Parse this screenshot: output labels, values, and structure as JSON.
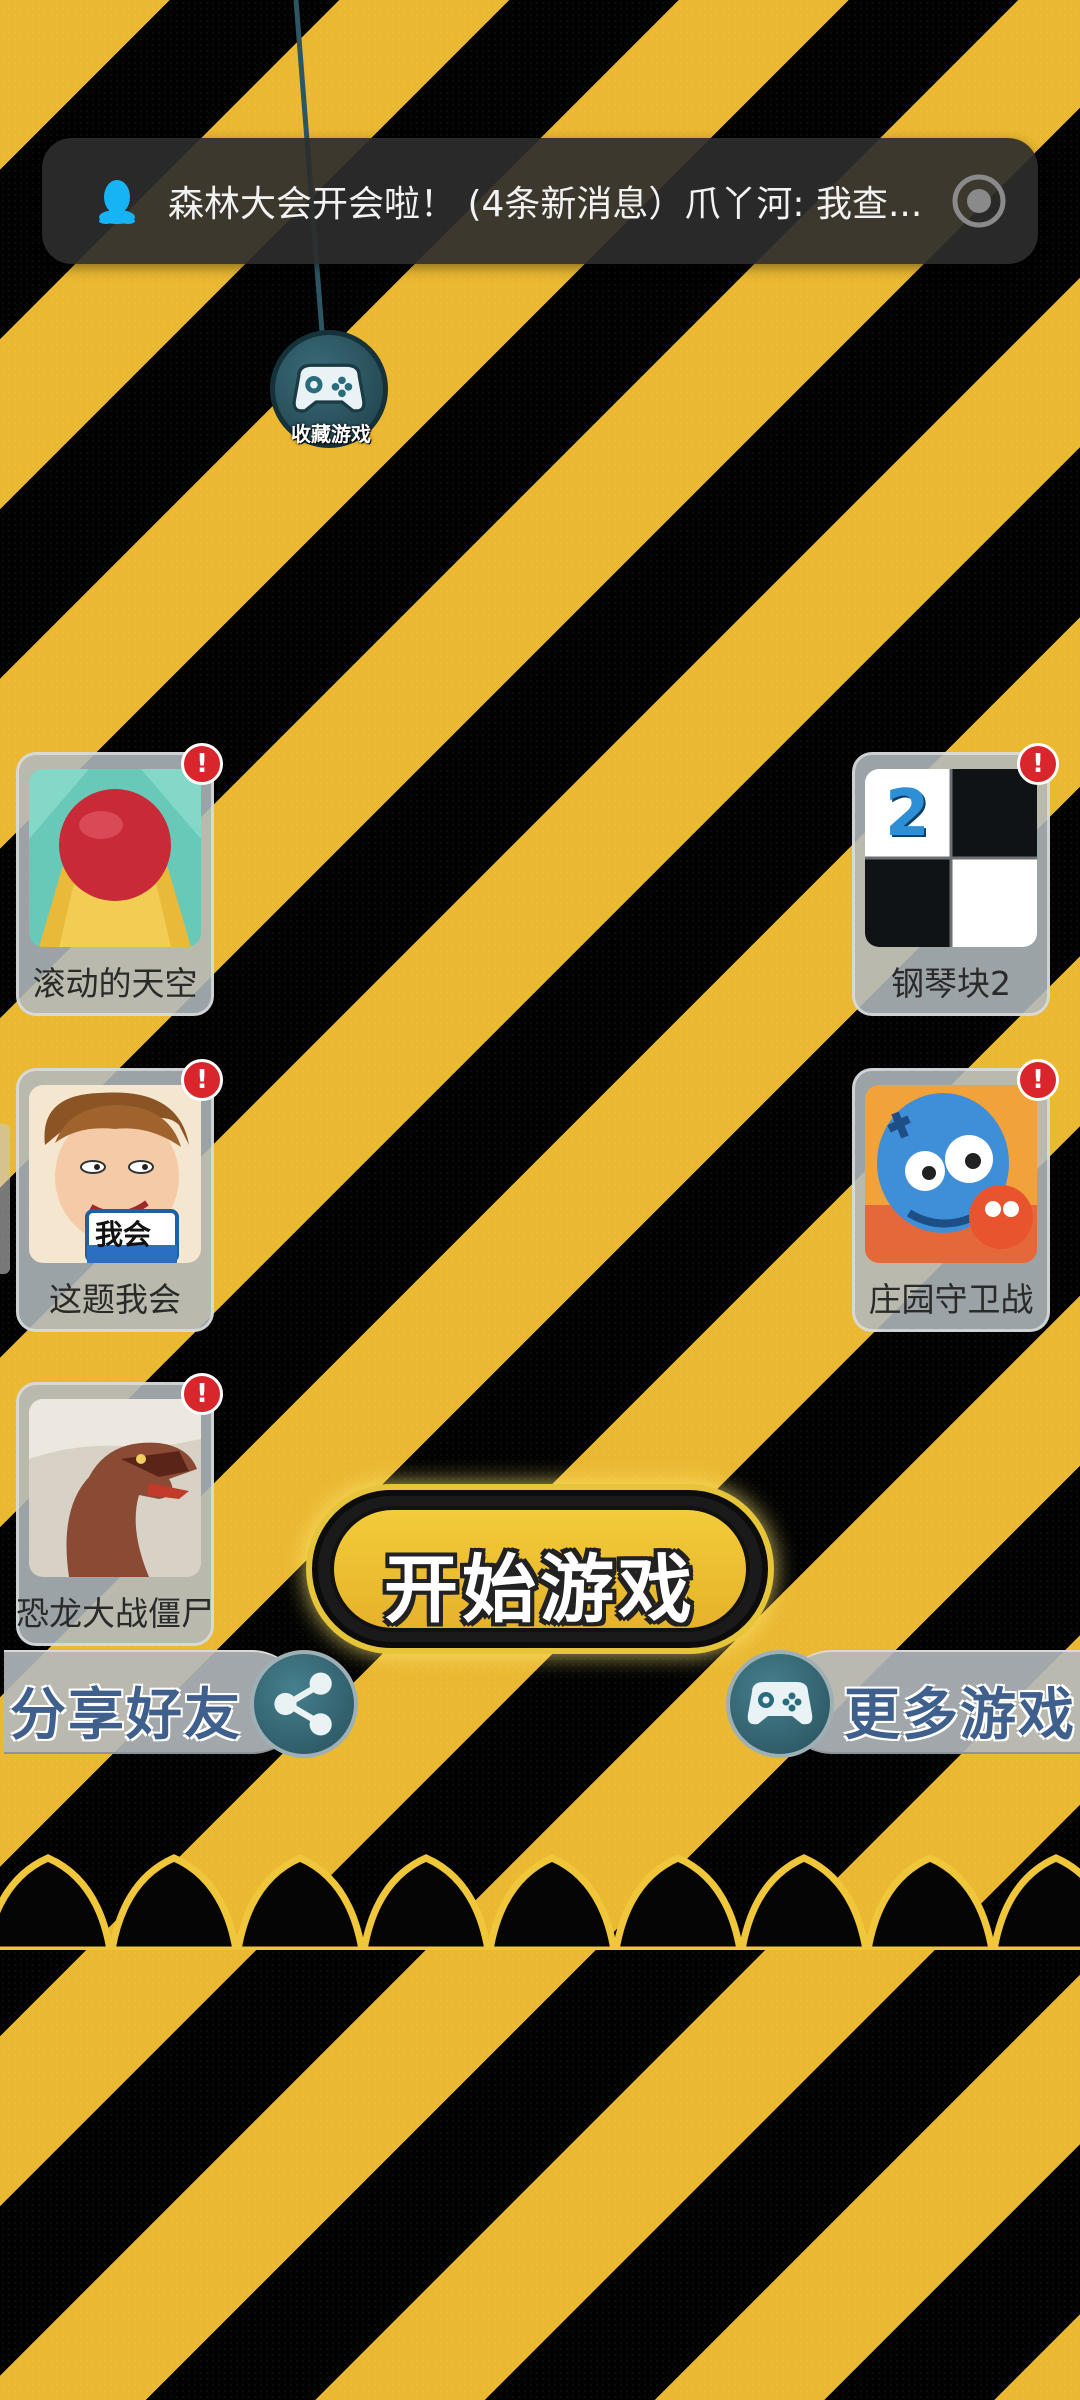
{
  "notification": {
    "app_icon": "qq-penguin-icon",
    "text": "森林大会开会啦！ (4条新消息）爪丫河: 我查...",
    "toggle_icon": "record-toggle-icon"
  },
  "favorite": {
    "label": "收藏游戏",
    "icon": "gamepad-icon"
  },
  "games": [
    {
      "title": "滚动的天空",
      "badge": "!"
    },
    {
      "title": "钢琴块2",
      "badge": "!",
      "tile_number": "2"
    },
    {
      "title": "这题我会",
      "badge": "!",
      "sign_text": "我会"
    },
    {
      "title": "庄园守卫战",
      "badge": "!"
    },
    {
      "title": "恐龙大战僵尸",
      "badge": "!"
    }
  ],
  "start_button": {
    "label": "开始游戏"
  },
  "share": {
    "label": "分享好友",
    "icon": "share-icon"
  },
  "more_games": {
    "label": "更多游戏",
    "icon": "gamepad-icon"
  },
  "colors": {
    "stripe_yellow": "#eab831",
    "stripe_black": "#020202",
    "badge_red": "#d8262c",
    "banner_text_blue": "#3f5f8c",
    "start_button_yellow": "#f2cc3a"
  }
}
